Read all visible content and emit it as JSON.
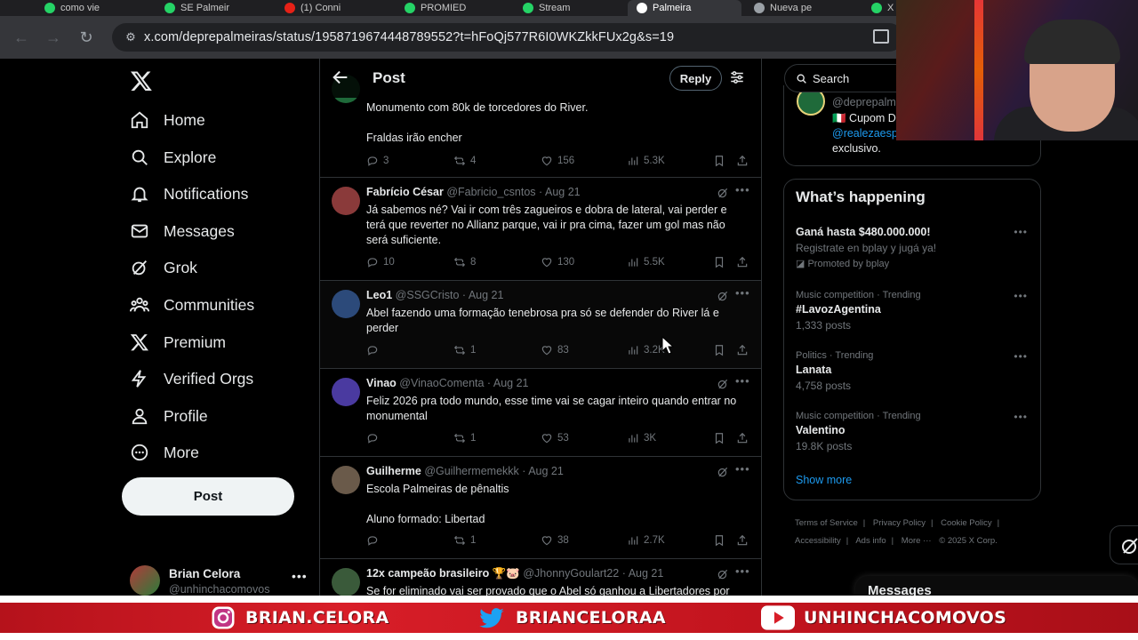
{
  "browser": {
    "tabs": [
      {
        "title": "como vie",
        "color": "#25d366"
      },
      {
        "title": "SE Palmeir",
        "color": "#25d366"
      },
      {
        "title": "(1) Conni",
        "color": "#e62117"
      },
      {
        "title": "PROMIED",
        "color": "#25d366"
      },
      {
        "title": "Stream",
        "color": "#25d366"
      },
      {
        "title": "Palmeira",
        "color": "#ffffff"
      },
      {
        "title": "Nueva pe",
        "color": "#9aa0a6"
      },
      {
        "title": "X",
        "color": "#25d366"
      }
    ],
    "url": "x.com/deprepalmeiras/status/1958719674448789552?t=hFoQj577R6I0WKZkkFUx2g&s=19"
  },
  "nav": {
    "items": [
      {
        "label": "Home",
        "icon": "home-icon"
      },
      {
        "label": "Explore",
        "icon": "search-icon"
      },
      {
        "label": "Notifications",
        "icon": "bell-icon"
      },
      {
        "label": "Messages",
        "icon": "envelope-icon"
      },
      {
        "label": "Grok",
        "icon": "grok-icon"
      },
      {
        "label": "Communities",
        "icon": "people-icon"
      },
      {
        "label": "Premium",
        "icon": "x-icon"
      },
      {
        "label": "Verified Orgs",
        "icon": "lightning-icon"
      },
      {
        "label": "Profile",
        "icon": "person-icon"
      },
      {
        "label": "More",
        "icon": "more-circle-icon"
      }
    ],
    "post_label": "Post",
    "account": {
      "name": "Brian Celora",
      "handle": "@unhinchacomovos"
    }
  },
  "header": {
    "title": "Post",
    "reply_label": "Reply"
  },
  "tweets": [
    {
      "name": "",
      "handle": "",
      "date": "",
      "lines": [
        "Monumento com 80k de torcedores do River.",
        "",
        "Fraldas irão encher"
      ],
      "replies": "3",
      "reposts": "4",
      "likes": "156",
      "views": "5.3K"
    },
    {
      "name": "Fabrício César",
      "handle": "@Fabricio_csntos",
      "date": "Aug 21",
      "lines": [
        "Já sabemos né? Vai ir com três zagueiros e dobra de lateral, vai perder e",
        "terá que reverter no Allianz parque, vai ir pra cima, fazer um gol mas não",
        "será suficiente."
      ],
      "replies": "10",
      "reposts": "8",
      "likes": "130",
      "views": "5.5K"
    },
    {
      "name": "Leo1",
      "handle": "@SSGCristo",
      "date": "Aug 21",
      "lines": [
        "Abel fazendo uma formação tenebrosa pra só se defender do River lá e",
        "perder"
      ],
      "replies": "",
      "reposts": "1",
      "likes": "83",
      "views": "3.2K"
    },
    {
      "name": "Vinao",
      "handle": "@VinaoComenta",
      "date": "Aug 21",
      "lines": [
        "Feliz 2026 pra todo mundo, esse time vai se cagar inteiro quando entrar no",
        "monumental"
      ],
      "replies": "",
      "reposts": "1",
      "likes": "53",
      "views": "3K"
    },
    {
      "name": "Guilherme",
      "handle": "@Guilhermemekkk",
      "date": "Aug 21",
      "lines": [
        "Escola Palmeiras de pênaltis",
        "",
        "Aluno formado: Libertad"
      ],
      "replies": "",
      "reposts": "1",
      "likes": "38",
      "views": "2.7K"
    },
    {
      "name": "12x campeão brasileiro 🏆🐷",
      "handle": "@JhonnyGoulart22",
      "date": "Aug 21",
      "lines": [
        "Se for eliminado vai ser provado que o Abel só ganhou a Libertadores por"
      ],
      "replies": "",
      "reposts": "",
      "likes": "",
      "views": ""
    }
  ],
  "right": {
    "search_placeholder": "Search",
    "card": {
      "handle": "@deprepalm",
      "line2": "🇮🇹 Cupom D",
      "line3": "@realezaesp",
      "line4": "exclusivo."
    },
    "happening_title": "What’s happening",
    "trends": [
      {
        "category": "",
        "title": "Ganá hasta $480.000.000!",
        "sub": "Registrate en bplay y jugá ya!",
        "promo": "Promoted by bplay"
      },
      {
        "category": "Music competition · Trending",
        "title": "#LavozAgentina",
        "sub": "1,333 posts"
      },
      {
        "category": "Politics · Trending",
        "title": "Lanata",
        "sub": "4,758 posts"
      },
      {
        "category": "Music competition · Trending",
        "title": "Valentino",
        "sub": "19.8K posts"
      }
    ],
    "show_more": "Show more",
    "footer": [
      "Terms of Service",
      "Privacy Policy",
      "Cookie Policy",
      "Accessibility",
      "Ads info",
      "More ···",
      "© 2025 X Corp."
    ],
    "messages_label": "Messages"
  },
  "banner": {
    "instagram": "BRIAN.CELORA",
    "twitter": "BRIANCELORAA",
    "youtube": "UNHINCHACOMOVOS",
    "colors": {
      "red": "#d81e28",
      "white": "#ffffff"
    }
  }
}
